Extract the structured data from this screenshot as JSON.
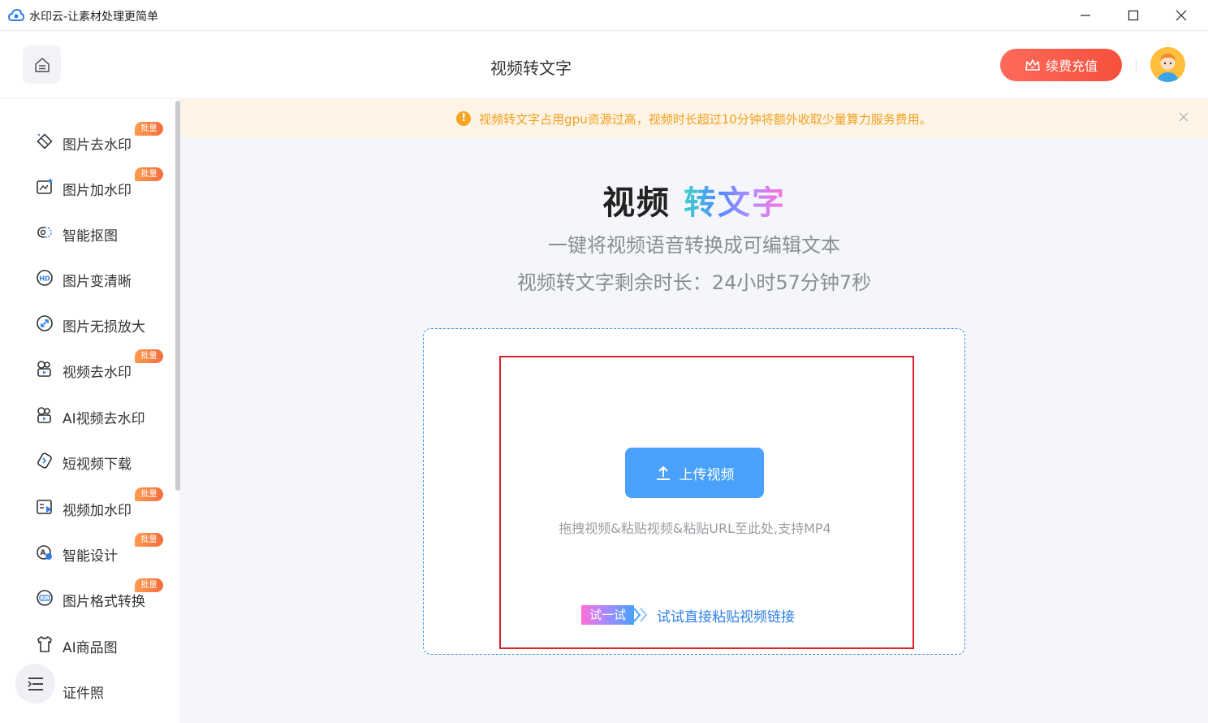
{
  "window": {
    "title": "水印云-让素材处理更简单"
  },
  "header": {
    "page_title": "视频转文字",
    "vip_label": "续费充值"
  },
  "sidebar": {
    "items": [
      {
        "label": "图片去水印",
        "badge": "批量",
        "icon": "image-eraser-icon"
      },
      {
        "label": "图片加水印",
        "badge": "批量",
        "icon": "image-add-watermark-icon"
      },
      {
        "label": "智能抠图",
        "badge": "",
        "icon": "smart-cutout-icon"
      },
      {
        "label": "图片变清晰",
        "badge": "",
        "icon": "hd-icon"
      },
      {
        "label": "图片无损放大",
        "badge": "",
        "icon": "enlarge-icon"
      },
      {
        "label": "视频去水印",
        "badge": "批量",
        "icon": "video-eraser-icon"
      },
      {
        "label": "AI视频去水印",
        "badge": "",
        "icon": "ai-video-eraser-icon"
      },
      {
        "label": "短视频下载",
        "badge": "",
        "icon": "download-icon"
      },
      {
        "label": "视频加水印",
        "badge": "批量",
        "icon": "video-add-watermark-icon"
      },
      {
        "label": "智能设计",
        "badge": "批量",
        "icon": "smart-design-icon"
      },
      {
        "label": "图片格式转换",
        "badge": "批量",
        "icon": "format-convert-icon"
      },
      {
        "label": "AI商品图",
        "badge": "",
        "icon": "shirt-icon"
      },
      {
        "label": "证件照",
        "badge": "",
        "icon": "id-photo-icon"
      }
    ]
  },
  "notice": {
    "text": "视频转文字占用gpu资源过高，视频时长超过10分钟将额外收取少量算力服务费用。"
  },
  "hero": {
    "title_dark": "视频",
    "title_grad": "转文字",
    "subtitle": "一键将视频语音转换成可编辑文本",
    "remaining": "视频转文字剩余时长：24小时57分钟7秒"
  },
  "upload": {
    "button_label": "上传视频",
    "hint": "拖拽视频&粘贴视频&粘贴URL至此处,支持MP4",
    "try_tag": "试一试",
    "try_link": "试试直接粘贴视频链接"
  },
  "colors": {
    "accent": "#4aa1fb",
    "vip": "#f5503c",
    "badge": "#f56c3c",
    "notice_text": "#f0a020",
    "highlight": "#d9242b"
  }
}
